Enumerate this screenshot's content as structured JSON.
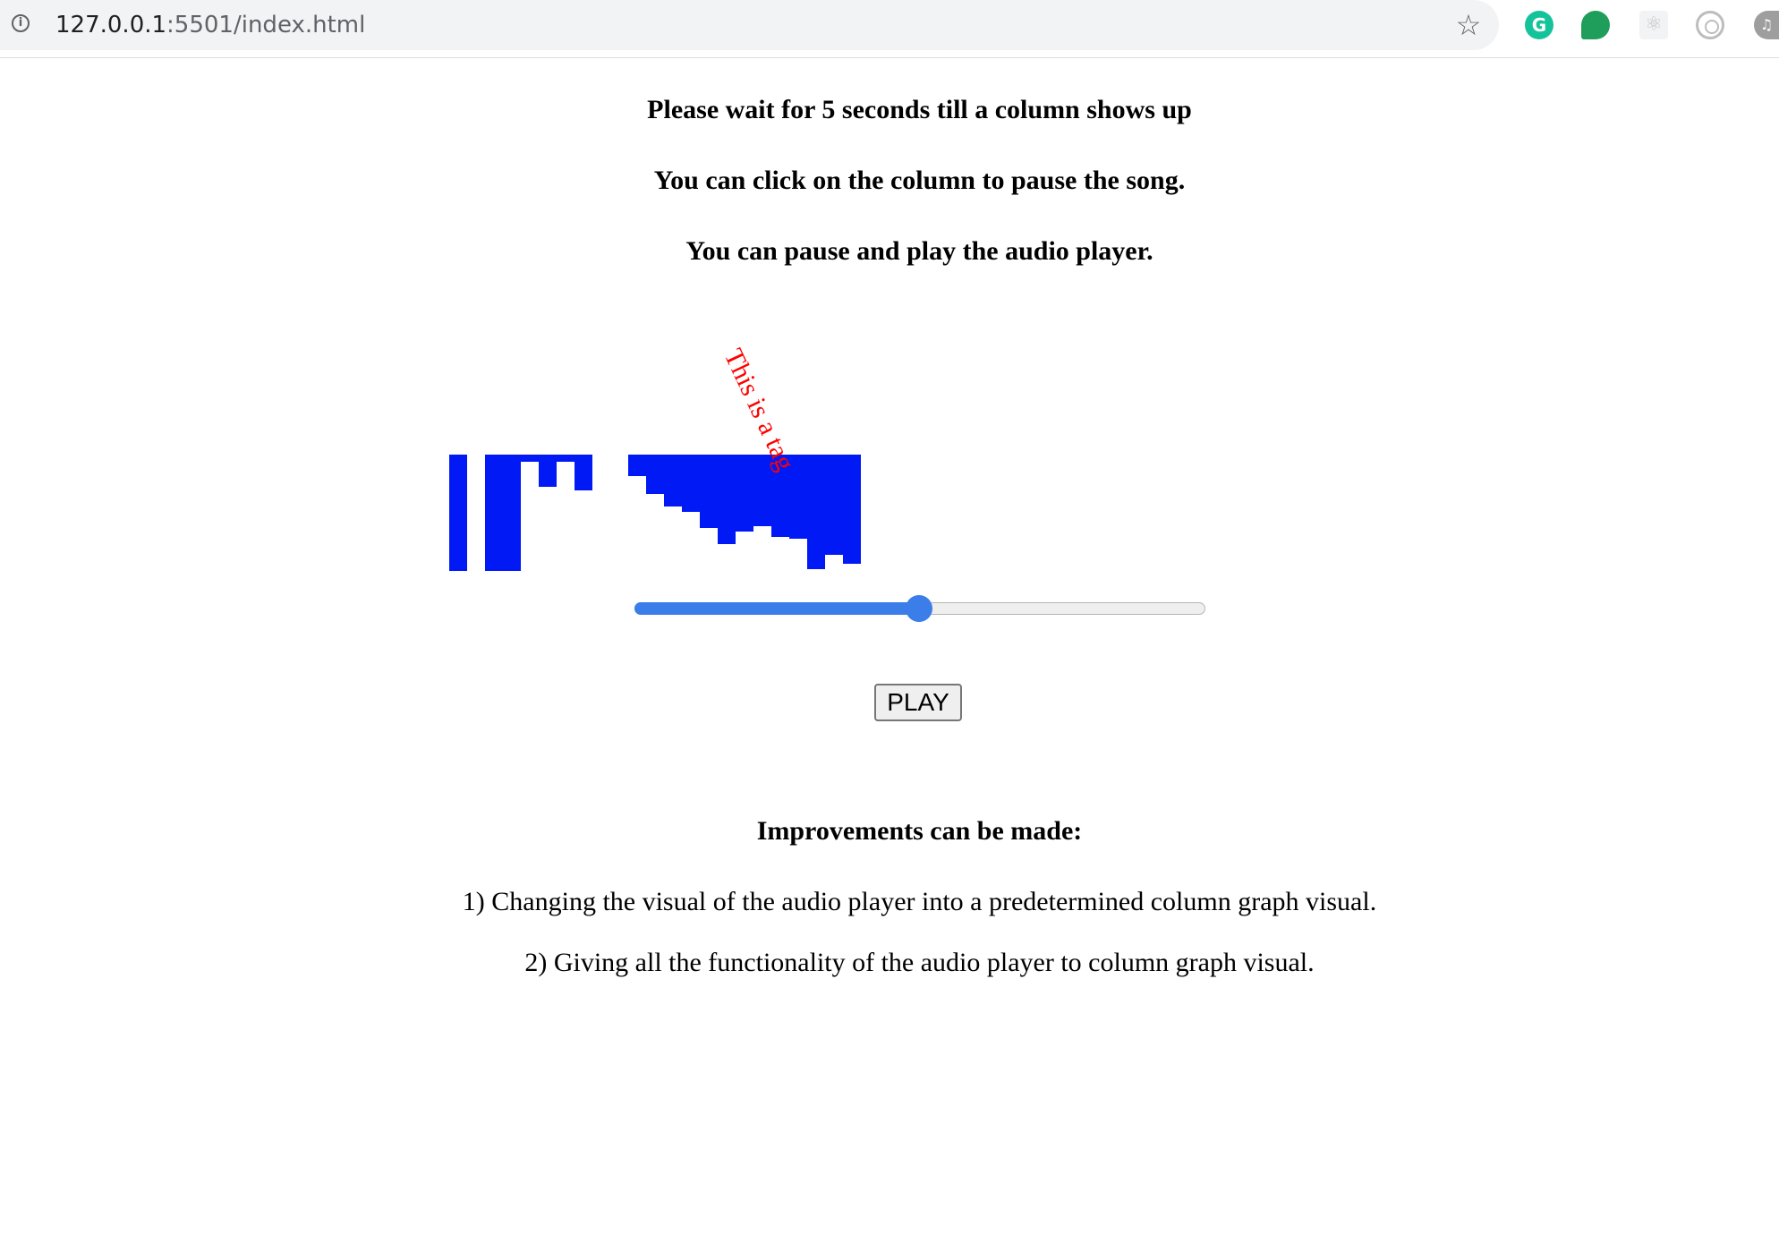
{
  "browser": {
    "url_host": "127.0.0.1",
    "url_rest": ":5501/index.html",
    "info_icon": "info-icon",
    "bookmark_icon": "star-icon",
    "extensions": [
      "grammarly-icon",
      "chat-bubble-icon",
      "react-devtools-icon",
      "target-icon",
      "music-icon"
    ]
  },
  "instructions": [
    "Please wait for 5 seconds till a column shows up",
    "You can click on the column to pause the song.",
    "You can pause and play the audio player."
  ],
  "visualizer": {
    "color": "#0019f5",
    "tag_text": "This is a tag",
    "tag_color": "#ff0000"
  },
  "player": {
    "progress": 0.5,
    "accent": "#3b7de9",
    "play_label": "PLAY"
  },
  "improvements": {
    "title": "Improvements can be made:",
    "items": [
      "1) Changing the visual of the audio player into a predetermined column graph visual.",
      "2) Giving all the functionality of the audio player to column graph visual."
    ]
  }
}
